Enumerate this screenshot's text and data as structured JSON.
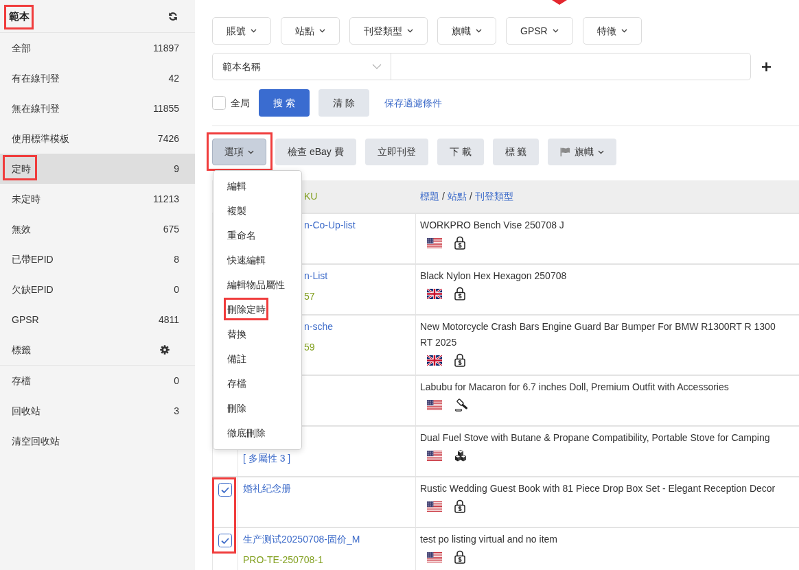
{
  "sidebar": {
    "title": {
      "text": "範本",
      "highlighted": true
    },
    "groups": [
      {
        "items": [
          {
            "label": "全部",
            "kind": "count",
            "count": "11897",
            "selected": false,
            "highlighted": false
          },
          {
            "label": "有在線刊登",
            "kind": "count",
            "count": "42",
            "selected": false,
            "highlighted": false
          },
          {
            "label": "無在線刊登",
            "kind": "count",
            "count": "11855",
            "selected": false,
            "highlighted": false
          },
          {
            "label": "使用標準模板",
            "kind": "count",
            "count": "7426",
            "selected": false,
            "highlighted": false
          },
          {
            "label": "定時",
            "kind": "count",
            "count": "9",
            "selected": true,
            "highlighted": true
          },
          {
            "label": "未定時",
            "kind": "count",
            "count": "11213",
            "selected": false,
            "highlighted": false
          },
          {
            "label": "無效",
            "kind": "count",
            "count": "675",
            "selected": false,
            "highlighted": false
          },
          {
            "label": "已帶EPID",
            "kind": "count",
            "count": "8",
            "selected": false,
            "highlighted": false
          },
          {
            "label": "欠缺EPID",
            "kind": "count",
            "count": "0",
            "selected": false,
            "highlighted": false
          },
          {
            "label": "GPSR",
            "kind": "count",
            "count": "4811",
            "selected": false,
            "highlighted": false
          },
          {
            "label": "標籤",
            "kind": "settings",
            "selected": false,
            "highlighted": false
          }
        ]
      },
      {
        "items": [
          {
            "label": "存檔",
            "kind": "count",
            "count": "0",
            "selected": false,
            "highlighted": false
          },
          {
            "label": "回收站",
            "kind": "count",
            "count": "3",
            "selected": false,
            "highlighted": false
          },
          {
            "label": "清空回收站",
            "kind": "plain",
            "selected": false,
            "highlighted": false
          }
        ]
      }
    ]
  },
  "filters": [
    {
      "label": "賬號"
    },
    {
      "label": "站點"
    },
    {
      "label": "刊登類型"
    },
    {
      "label": "旗幟"
    },
    {
      "label": "GPSR"
    },
    {
      "label": "特徵"
    }
  ],
  "search": {
    "field": "範本名稱"
  },
  "search_controls": {
    "global": {
      "label": "全局",
      "checked": false
    },
    "search_button": "搜 索",
    "clear_button": "清 除",
    "save_link": "保存過濾條件"
  },
  "actions": [
    {
      "label": "選項",
      "kind": "menu",
      "open": true,
      "highlighted": true
    },
    {
      "label": "檢查 eBay 費",
      "kind": "plain",
      "open": false,
      "highlighted": false
    },
    {
      "label": "立即刊登",
      "kind": "plain",
      "open": false,
      "highlighted": false
    },
    {
      "label": "下 載",
      "kind": "plain",
      "open": false,
      "highlighted": false
    },
    {
      "label": "標 籤",
      "kind": "plain",
      "open": false,
      "highlighted": false
    },
    {
      "label": "旗幟",
      "kind": "flag",
      "open": false,
      "highlighted": false
    }
  ],
  "options_menu": {
    "items": [
      {
        "label": "編輯",
        "highlighted": false
      },
      {
        "label": "複製",
        "highlighted": false
      },
      {
        "label": "重命名",
        "highlighted": false
      },
      {
        "label": "快速編輯",
        "highlighted": false
      },
      {
        "label": "編輯物品屬性",
        "highlighted": false
      },
      {
        "label": "刪除定時",
        "highlighted": true
      },
      {
        "label": "替換",
        "highlighted": false
      },
      {
        "label": "備註",
        "highlighted": false
      },
      {
        "label": "存檔",
        "highlighted": false
      },
      {
        "label": "刪除",
        "highlighted": false
      },
      {
        "label": "徹底刪除",
        "highlighted": false
      }
    ]
  },
  "table": {
    "columns": [
      {
        "kind": "code",
        "text": "KU"
      },
      {
        "kind": "links",
        "links": [
          "標題",
          "站點",
          "刊登類型"
        ],
        "separator": "/"
      }
    ],
    "rows": [
      {
        "sku": [
          {
            "kind": "name",
            "text": "n-Co-Up-list"
          }
        ],
        "title": "WORKPRO Bench Vise 250708 J",
        "site": {
          "kind": "us"
        },
        "format": {
          "kind": "fixed"
        }
      },
      {
        "sku": [
          {
            "kind": "name",
            "text": "n-List"
          },
          {
            "kind": "code",
            "text": "57"
          }
        ],
        "title": "Black Nylon Hex Hexagon 250708",
        "site": {
          "kind": "uk"
        },
        "format": {
          "kind": "fixed"
        }
      },
      {
        "sku": [
          {
            "kind": "name",
            "text": "n-sche"
          },
          {
            "kind": "code",
            "text": "59"
          }
        ],
        "title": "New Motorcycle Crash Bars Engine Guard Bar Bumper For BMW R1300RT R 1300 RT 2025",
        "site": {
          "kind": "uk"
        },
        "format": {
          "kind": "fixed"
        }
      },
      {
        "title": "Labubu for Macaron for 6.7 inches Doll, Premium Outfit with Accessories",
        "site": {
          "kind": "us"
        },
        "format": {
          "kind": "auction"
        }
      },
      {
        "sku": [
          {
            "kind": "variants",
            "text": "[ 多屬性 3 ]"
          }
        ],
        "title": "Dual Fuel Stove with Butane & Propane Compatibility, Portable Stove for Camping",
        "site": {
          "kind": "us"
        },
        "format": {
          "kind": "variations"
        }
      },
      {
        "checked": true,
        "highlighted": true,
        "sku": [
          {
            "kind": "name",
            "text": "婚礼纪念册"
          }
        ],
        "title": "Rustic Wedding Guest Book with 81 Piece Drop Box Set - Elegant Reception Decor",
        "site": {
          "kind": "us"
        },
        "format": {
          "kind": "fixed"
        }
      },
      {
        "checked": true,
        "highlighted": true,
        "sku": [
          {
            "kind": "name",
            "text": "生产测试20250708-固价_M"
          },
          {
            "kind": "code",
            "text": "PRO-TE-250708-1"
          }
        ],
        "title": "test po listing virtual and no item",
        "site": {
          "kind": "us"
        },
        "format": {
          "kind": "fixed"
        }
      }
    ]
  }
}
